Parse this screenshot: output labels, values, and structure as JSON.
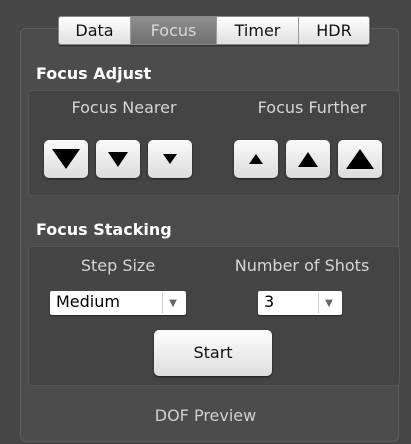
{
  "tabs": [
    {
      "label": "Data",
      "active": false
    },
    {
      "label": "Focus",
      "active": true
    },
    {
      "label": "Timer",
      "active": false
    },
    {
      "label": "HDR",
      "active": false
    }
  ],
  "focus_adjust": {
    "title": "Focus Adjust",
    "nearer_label": "Focus Nearer",
    "further_label": "Focus Further",
    "nearer_buttons": [
      "large-down-arrow",
      "medium-down-arrow",
      "small-down-arrow"
    ],
    "further_buttons": [
      "small-up-arrow",
      "medium-up-arrow",
      "large-up-arrow"
    ]
  },
  "focus_stacking": {
    "title": "Focus Stacking",
    "step_size_label": "Step Size",
    "shots_label": "Number of Shots",
    "step_size_value": "Medium",
    "shots_value": "3",
    "start_label": "Start"
  },
  "footer": {
    "dof_preview_label": "DOF Preview"
  },
  "colors": {
    "background": "#4a4a4a",
    "active_tab": "#7d7d7d",
    "button": "#f0f0f0"
  }
}
